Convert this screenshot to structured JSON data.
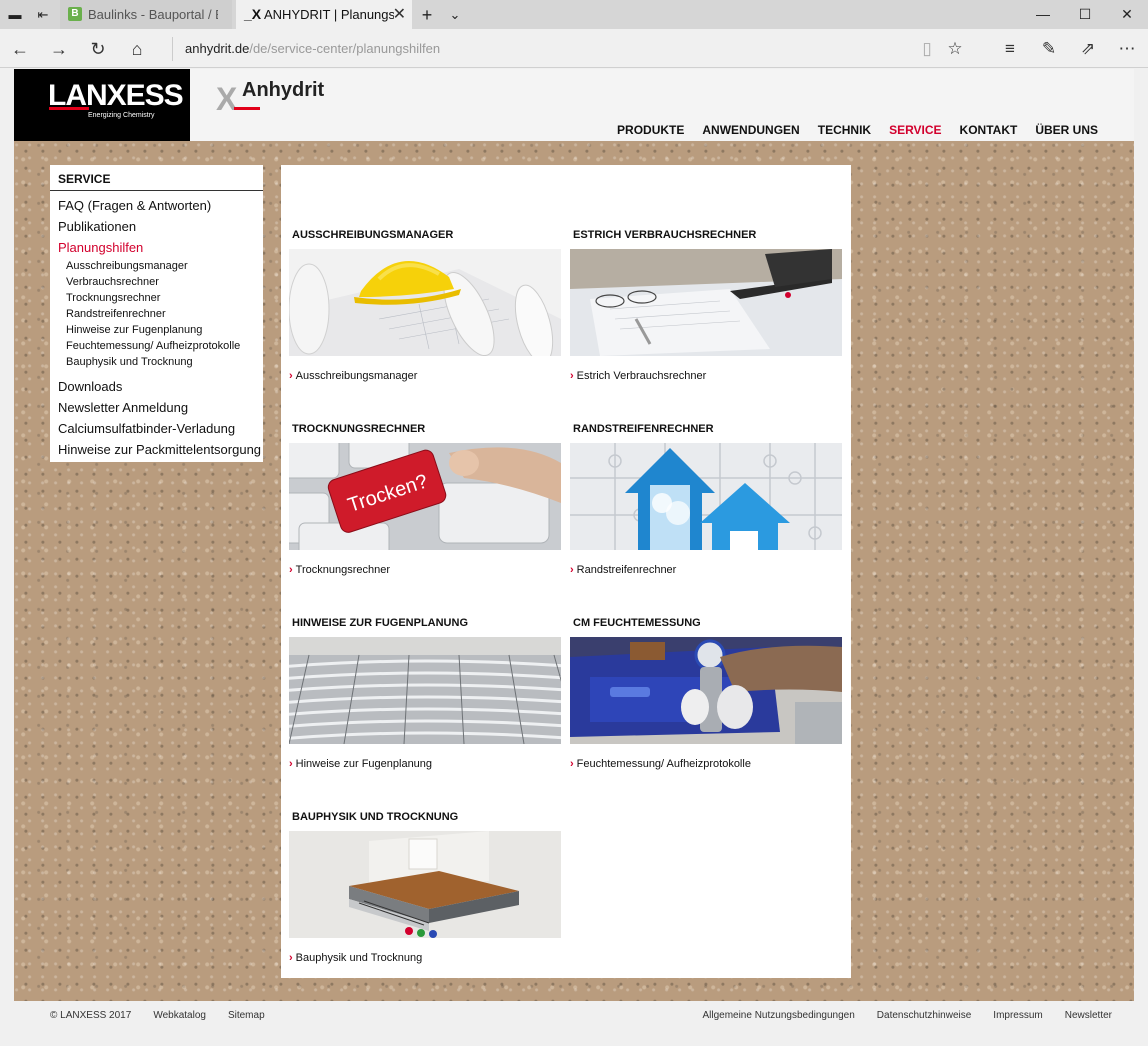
{
  "browser": {
    "tabs": [
      {
        "label": "Baulinks - Bauportal / Baum",
        "favicon": "B"
      },
      {
        "label": "ANHYDRIT | Planungshi",
        "favicon": "_X"
      }
    ],
    "url_host": "anhydrit.de",
    "url_path": "/de/service-center/planungshilfen"
  },
  "header": {
    "lanxess_logo": "LANXESS",
    "lanxess_tagline": "Energizing Chemistry",
    "anhydrit_x": "X",
    "anhydrit_logo": "Anhydrit",
    "nav": [
      "PRODUKTE",
      "ANWENDUNGEN",
      "TECHNIK",
      "SERVICE",
      "KONTAKT",
      "ÜBER UNS"
    ],
    "nav_active": "SERVICE"
  },
  "sidebar": {
    "heading": "SERVICE",
    "items": [
      "FAQ (Fragen & Antworten)",
      "Publikationen",
      "Planungshilfen",
      "Downloads",
      "Newsletter Anmeldung",
      "Calciumsulfatbinder-Verladung",
      "Hinweise zur Packmittelentsorgung"
    ],
    "active": "Planungshilfen",
    "subitems": [
      "Ausschreibungsmanager",
      "Verbrauchsrechner",
      "Trocknungsrechner",
      "Randstreifenrechner",
      "Hinweise zur Fugenplanung",
      "Feuchtemessung/ Aufheizprotokolle",
      "Bauphysik und Trocknung"
    ]
  },
  "cards": [
    {
      "title": "AUSSCHREIBUNGSMANAGER",
      "link": "Ausschreibungsmanager",
      "image": "hardhat-blueprints"
    },
    {
      "title": "ESTRICH VERBRAUCHSRECHNER",
      "link": "Estrich Verbrauchsrechner",
      "image": "laptop-documents"
    },
    {
      "title": "TROCKNUNGSRECHNER",
      "link": "Trocknungsrechner",
      "image": "keyboard-trocken-key",
      "image_text": "Trocken?"
    },
    {
      "title": "RANDSTREIFENRECHNER",
      "link": "Randstreifenrechner",
      "image": "puzzle-houses"
    },
    {
      "title": "HINWEISE ZUR FUGENPLANUNG",
      "link": "Hinweise zur Fugenplanung",
      "image": "underfloor-heating-pipes"
    },
    {
      "title": "CM FEUCHTEMESSUNG",
      "link": "Feuchtemessung/ Aufheizprotokolle",
      "image": "moisture-test-kit"
    },
    {
      "title": "BAUPHYSIK UND TROCKNUNG",
      "link": "Bauphysik und Trocknung",
      "image": "floor-cross-section"
    }
  ],
  "footer": {
    "left": [
      "© LANXESS 2017",
      "Webkatalog",
      "Sitemap"
    ],
    "right": [
      "Allgemeine Nutzungsbedingungen",
      "Datenschutzhinweise",
      "Impressum",
      "Newsletter"
    ]
  },
  "colors": {
    "accent": "#d2002d",
    "brand_red": "#e2001a"
  }
}
